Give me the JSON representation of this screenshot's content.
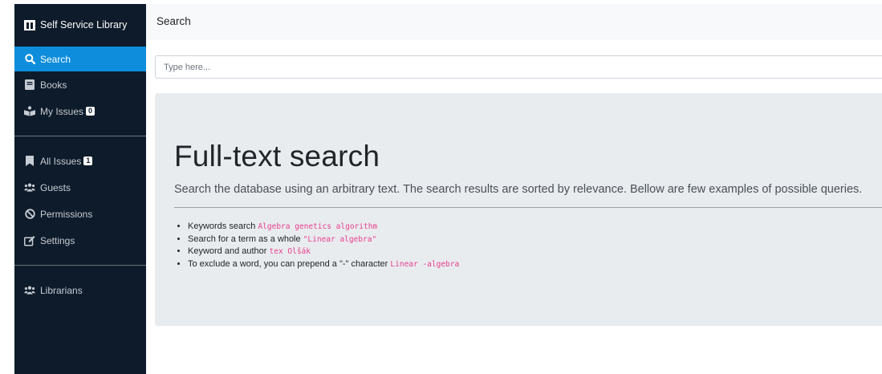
{
  "sidebar": {
    "brand": "Self Service Library",
    "items": [
      {
        "label": "Search",
        "icon": "search-icon",
        "active": true
      },
      {
        "label": "Books",
        "icon": "book-icon"
      },
      {
        "label": "My Issues",
        "icon": "reading-icon",
        "badge": "0"
      }
    ],
    "items2": [
      {
        "label": "All Issues",
        "icon": "bookmark-icon",
        "badge": "1"
      },
      {
        "label": "Guests",
        "icon": "users-icon"
      },
      {
        "label": "Permissions",
        "icon": "ban-icon"
      },
      {
        "label": "Settings",
        "icon": "edit-icon"
      }
    ],
    "items3": [
      {
        "label": "Librarians",
        "icon": "users-icon"
      }
    ]
  },
  "header": {
    "title": "Search"
  },
  "search": {
    "placeholder": "Type here..."
  },
  "jumbotron": {
    "title": "Full-text search",
    "lead": "Search the database using an arbitrary text. The search results are sorted by relevance. Bellow are few examples of possible queries.",
    "examples": [
      {
        "text": "Keywords search ",
        "code": "Algebra genetics algorithm"
      },
      {
        "text": "Search for a term as a whole ",
        "code": "\"Linear algebra\""
      },
      {
        "text": "Keyword and author ",
        "code": "tex Olšák"
      },
      {
        "text": "To exclude a word, you can prepend a \"-\" character ",
        "code": "Linear -algebra"
      }
    ]
  },
  "colors": {
    "sidebar_bg": "#0d1b2a",
    "active": "#0d8ddb",
    "code": "#e83e8c",
    "jumbotron_bg": "#e9ecef"
  }
}
